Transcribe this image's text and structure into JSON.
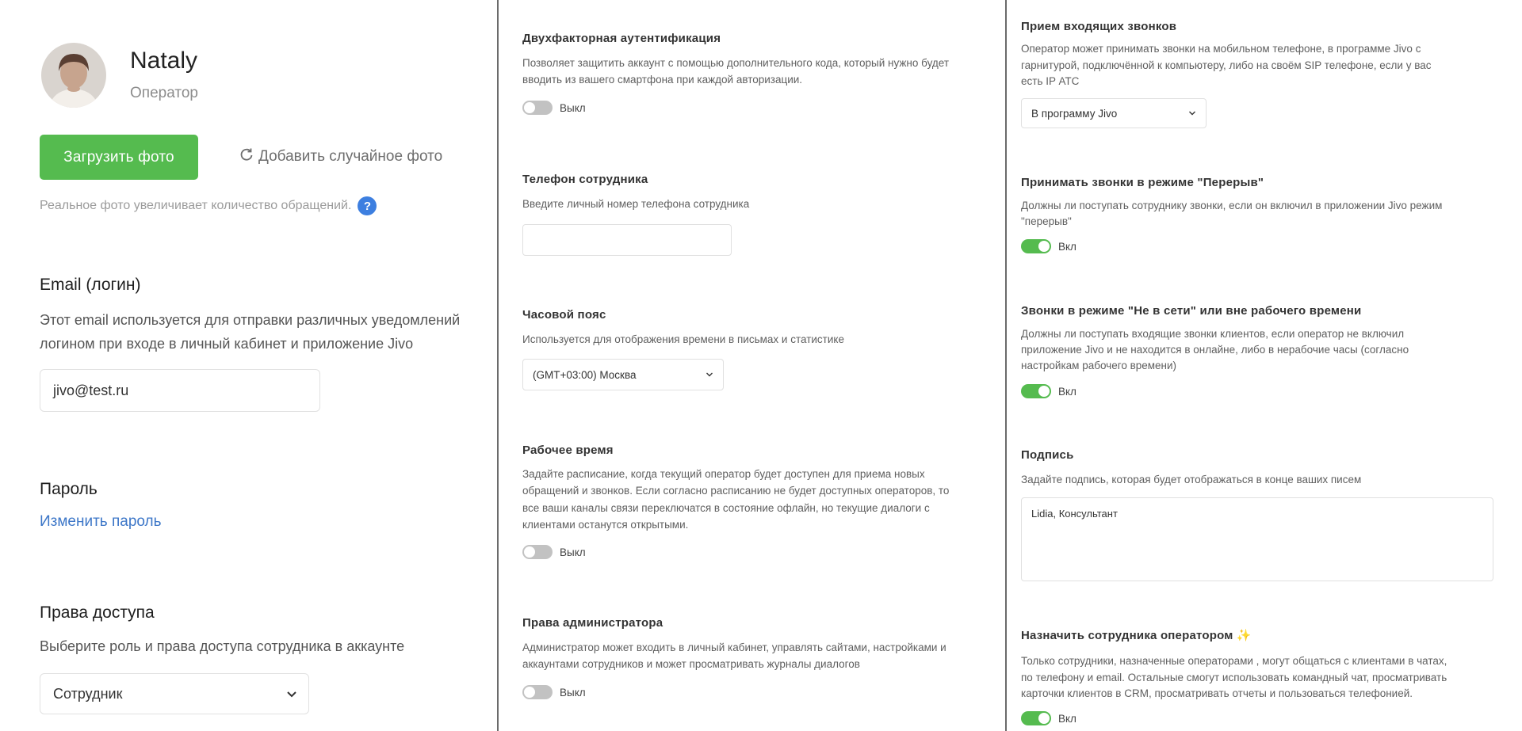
{
  "profile": {
    "name": "Nataly",
    "role": "Оператор",
    "upload_label": "Загрузить фото",
    "random_label": "Добавить случайное фото",
    "hint": "Реальное фото увеличивает количество обращений.",
    "help_glyph": "?"
  },
  "email": {
    "title": "Email (логин)",
    "desc_line1": "Этот email используется для отправки различных уведомлений",
    "desc_line2": "логином при входе в личный кабинет и приложение Jivo",
    "value": "jivo@test.ru"
  },
  "password": {
    "title": "Пароль",
    "change_link": "Изменить пароль"
  },
  "access": {
    "title": "Права доступа",
    "desc": "Выберите роль и права доступа сотрудника в аккаунте",
    "selected": "Сотрудник"
  },
  "two_factor": {
    "title": "Двухфакторная аутентификация",
    "desc_line1": "Позволяет защитить аккаунт с помощью дополнительного кода, который нужно будет",
    "desc_line2": "вводить из вашего смартфона при каждой авторизации.",
    "state_label": "Выкл",
    "enabled": false
  },
  "phone": {
    "title": "Телефон сотрудника",
    "desc": "Введите личный номер телефона сотрудника",
    "value": ""
  },
  "timezone": {
    "title": "Часовой пояс",
    "desc": "Используется для отображения времени в письмах и статистике",
    "selected": "(GMT+03:00) Москва"
  },
  "work_time": {
    "title": "Рабочее время",
    "desc_line1": "Задайте расписание, когда текущий оператор будет доступен для приема новых",
    "desc_line2": "обращений и звонков. Если согласно расписанию не будет доступных операторов, то",
    "desc_line3": "все ваши каналы связи переключатся в состояние офлайн, но текущие диалоги с",
    "desc_line4": "клиентами останутся открытыми.",
    "state_label": "Выкл",
    "enabled": false
  },
  "admin": {
    "title": "Права администратора",
    "desc_line1": "Администратор может входить в личный кабинет, управлять сайтами, настройками и",
    "desc_line2": "аккаунтами сотрудников и может просматривать журналы диалогов",
    "state_label": "Выкл",
    "enabled": false
  },
  "incoming_calls": {
    "title": "Прием входящих звонков",
    "desc_line1": "Оператор может принимать звонки на мобильном телефоне, в программе Jivo с",
    "desc_line2": "гарнитурой, подключённой к компьютеру, либо на своём SIP телефоне, если у вас",
    "desc_line3": "есть IP АТС",
    "selected": "В программу Jivo"
  },
  "break_calls": {
    "title": "Принимать звонки в режиме \"Перерыв\"",
    "desc_line1": "Должны ли поступать сотруднику звонки, если он включил в приложении Jivo режим",
    "desc_line2": "\"перерыв\"",
    "state_label": "Вкл",
    "enabled": true
  },
  "offline_calls": {
    "title": "Звонки в режиме \"Не в сети\" или вне рабочего времени",
    "desc_line1": "Должны ли поступать входящие звонки клиентов, если оператор не включил",
    "desc_line2": "приложение Jivo и не находится в онлайне, либо в нерабочие часы (согласно",
    "desc_line3": "настройкам рабочего времени)",
    "state_label": "Вкл",
    "enabled": true
  },
  "signature": {
    "title": "Подпись",
    "desc": "Задайте подпись, которая будет отображаться в конце ваших писем",
    "value": "Lidia, Консультант"
  },
  "assign_operator": {
    "title": "Назначить сотрудника оператором",
    "emoji": "✨",
    "desc_line1": "Только сотрудники, назначенные операторами , могут общаться с клиентами в чатах,",
    "desc_line2": "по телефону и email. Остальные смогут использовать командный чат, просматривать",
    "desc_line3": "карточки клиентов в CRM, просматривать отчеты и пользоваться телефонией.",
    "state_label": "Вкл",
    "enabled": true
  },
  "colors": {
    "accent_green": "#55bb4f",
    "link_blue": "#3d77c8",
    "help_blue": "#3d7fe0",
    "toggle_off": "#c2c2c2"
  }
}
